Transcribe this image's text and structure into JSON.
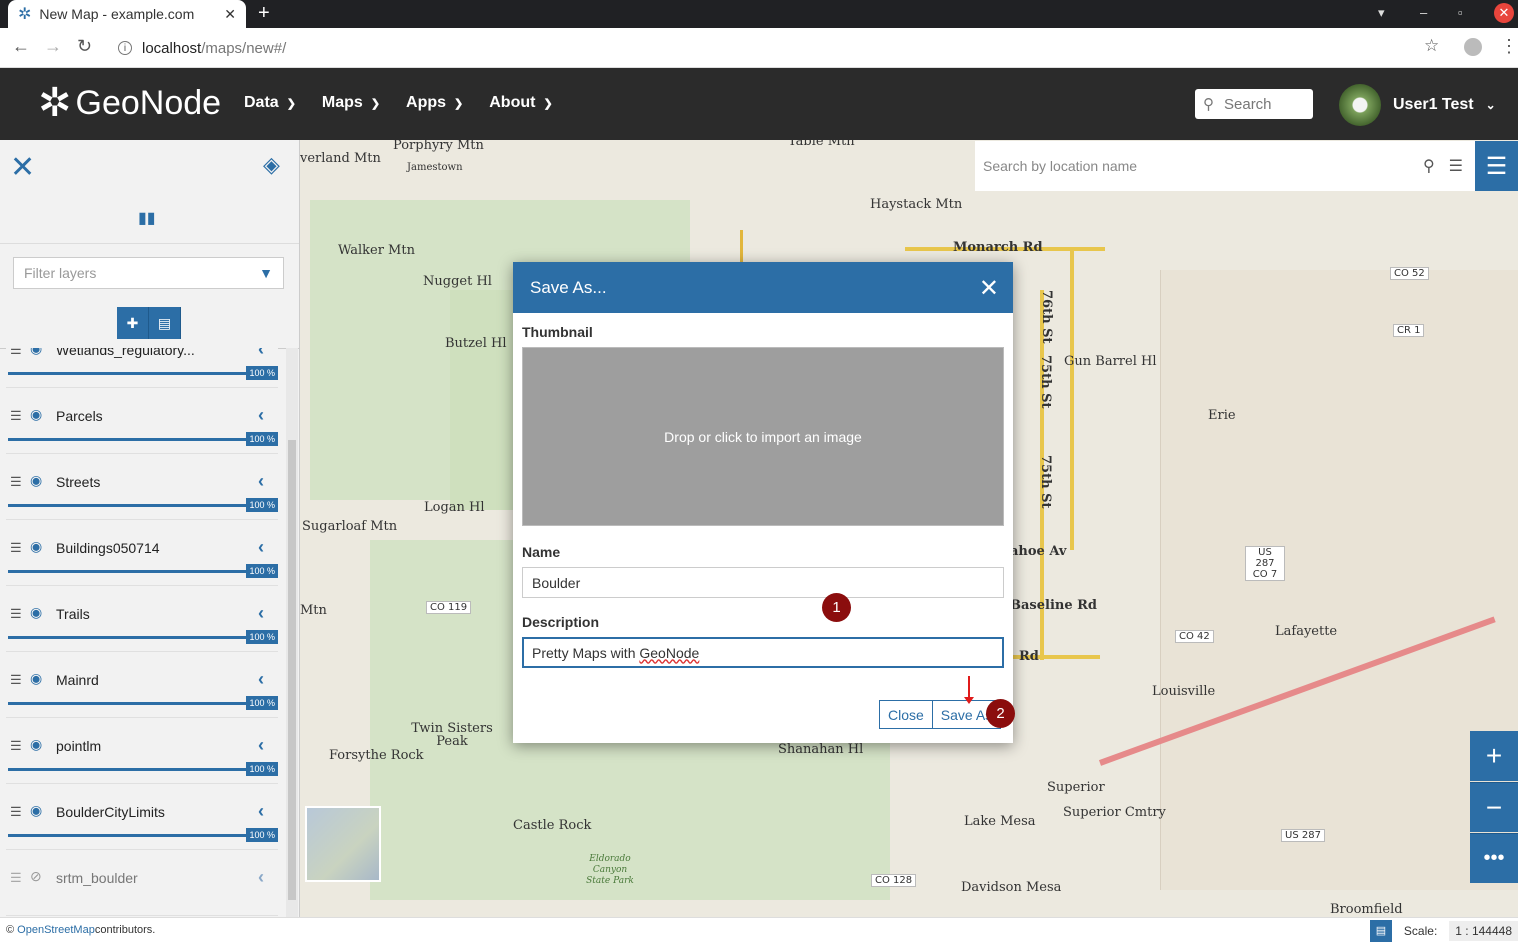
{
  "browser": {
    "tab_title": "New Map - example.com",
    "url_host": "localhost",
    "url_path": "/maps/new#/"
  },
  "header": {
    "logo": "GeoNode",
    "nav": [
      "Data",
      "Maps",
      "Apps",
      "About"
    ],
    "search_placeholder": "Search",
    "user_name": "User1 Test"
  },
  "sidebar": {
    "filter_placeholder": "Filter layers",
    "layers": [
      {
        "name": "Wetlands_regulatory...",
        "opacity": "100 %",
        "visible": true
      },
      {
        "name": "Parcels",
        "opacity": "100 %",
        "visible": true
      },
      {
        "name": "Streets",
        "opacity": "100 %",
        "visible": true
      },
      {
        "name": "Buildings050714",
        "opacity": "100 %",
        "visible": true
      },
      {
        "name": "Trails",
        "opacity": "100 %",
        "visible": true
      },
      {
        "name": "Mainrd",
        "opacity": "100 %",
        "visible": true
      },
      {
        "name": "pointlm",
        "opacity": "100 %",
        "visible": true
      },
      {
        "name": "BoulderCityLimits",
        "opacity": "100 %",
        "visible": true
      },
      {
        "name": "srtm_boulder",
        "opacity": "",
        "visible": false
      }
    ]
  },
  "map": {
    "search_placeholder": "Search by location name",
    "labels": [
      "Porphyry Mtn",
      "Jamestown",
      "verland Mtn",
      "Table Mtn",
      "Haystack Mtn",
      "Monarch Rd",
      "Walker Mtn",
      "Nugget Hl",
      "Butzel Hl",
      "Gun Barrel Hl",
      "Erie",
      "Logan Hl",
      "Sugarloaf Mtn",
      "Mtn",
      "CO 119",
      "ahoe Av",
      "Baseline Rd",
      "Rd",
      "Lafayette",
      "Louisville",
      "Twin Sisters Peak",
      "Forsythe Rock",
      "Shanahan Hl",
      "Superior",
      "Superior Cmtry",
      "Castle Rock",
      "Lake Mesa",
      "Eldorado Canyon State Park",
      "CO 128",
      "Davidson Mesa",
      "Broomfield",
      "CO 52",
      "CR 1",
      "US 287 CO 7",
      "CO 42",
      "US 287",
      "76th St",
      "75th St",
      "75th St"
    ],
    "attribution_link": "OpenStreetMap",
    "attribution_text": " contributors.",
    "scale_label": "Scale:",
    "scale_value": "1 : 144448"
  },
  "modal": {
    "title": "Save As...",
    "thumbnail_label": "Thumbnail",
    "dropzone_text": "Drop or click to import an image",
    "name_label": "Name",
    "name_value": "Boulder",
    "description_label": "Description",
    "description_prefix": "Pretty Maps with ",
    "description_suffix": "GeoNode",
    "close_button": "Close",
    "save_button": "Save As"
  },
  "annotations": [
    "1",
    "2"
  ],
  "colors": {
    "primary": "#2c6ea6",
    "header": "#2b2b2b",
    "badge": "#8b0d0d"
  }
}
